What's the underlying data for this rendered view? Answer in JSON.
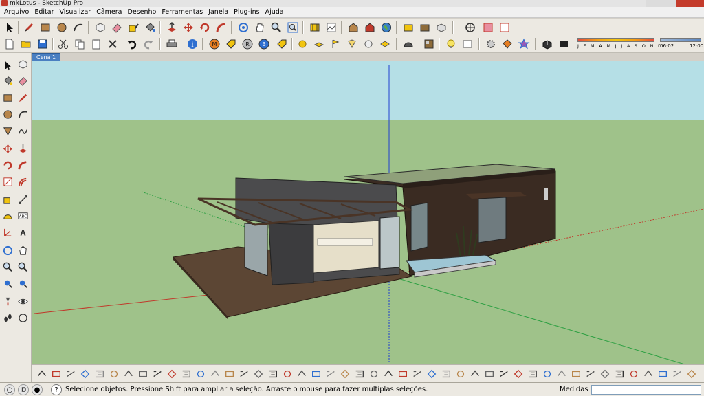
{
  "window": {
    "title": "mkLotus - SketchUp Pro"
  },
  "menu": [
    "Arquivo",
    "Editar",
    "Visualizar",
    "Câmera",
    "Desenho",
    "Ferramentas",
    "Janela",
    "Plug-ins",
    "Ajuda"
  ],
  "scene_tab": "Cena 1",
  "shadow": {
    "months": "J F M A M J J A S O N D",
    "time_start": "06:02",
    "time_end": "12:00"
  },
  "status": {
    "message": "Selecione objetos. Pressione Shift para ampliar a seleção. Arraste o mouse para fazer múltiplas seleções.",
    "measure_label": "Medidas",
    "measure_value": ""
  },
  "colors": {
    "sky": "#b5dfe6",
    "ground": "#9fc28a",
    "deck": "#5c4634",
    "walls": "#3a2b22",
    "volume": "#4b4b4d"
  }
}
